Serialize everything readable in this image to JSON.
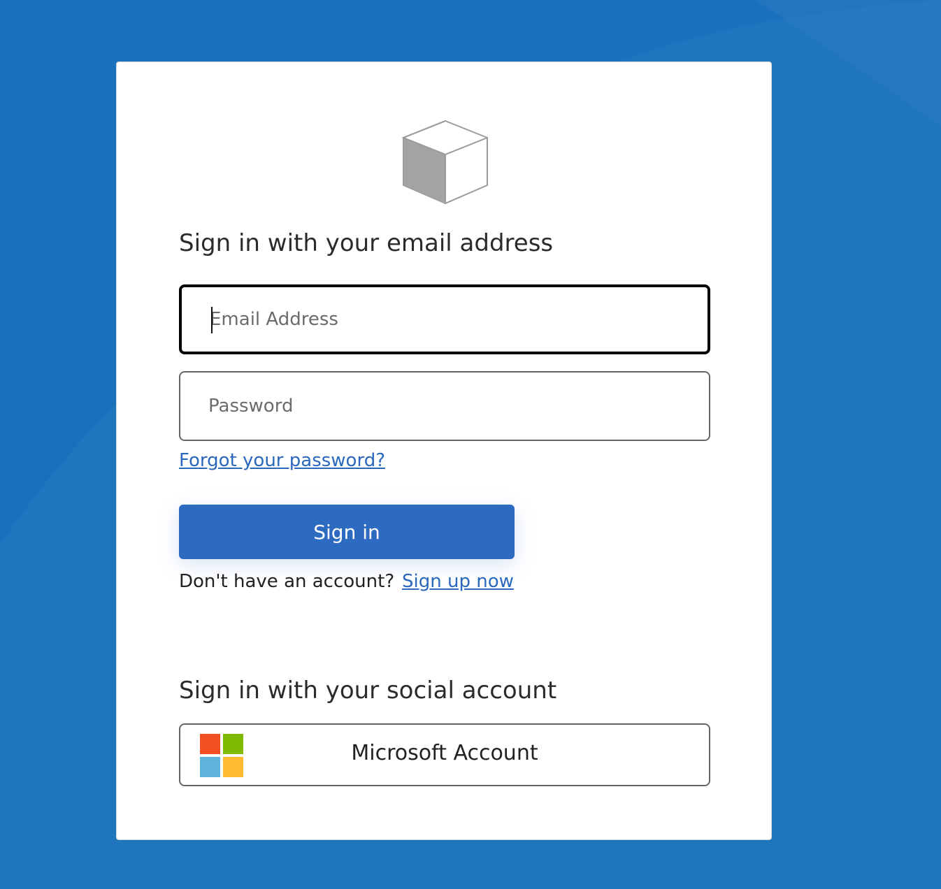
{
  "email_section": {
    "heading": "Sign in with your email address",
    "email_placeholder": "Email Address",
    "password_placeholder": "Password",
    "forgot_password_link": "Forgot your password?",
    "sign_in_button": "Sign in",
    "signup_question": "Don't have an account?",
    "signup_link": "Sign up now"
  },
  "social_section": {
    "heading": "Sign in with your social account",
    "microsoft_button": "Microsoft Account"
  },
  "icons": {
    "logo": "cube-icon",
    "microsoft": "microsoft-logo-icon"
  },
  "colors": {
    "background": "#1b70bb",
    "card": "#ffffff",
    "primary_button": "#2d6bc0",
    "link": "#2a68bd",
    "microsoft_red": "#f25022",
    "microsoft_green": "#7fba00",
    "microsoft_blue": "#00a4ef",
    "microsoft_yellow": "#ffb900"
  }
}
